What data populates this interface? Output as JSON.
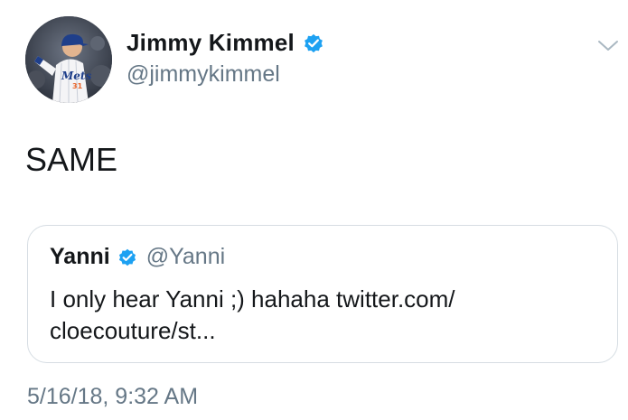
{
  "tweet": {
    "author": {
      "name": "Jimmy Kimmel",
      "handle": "@jimmykimmel",
      "verified": true,
      "avatar_icon": "profile-photo"
    },
    "text": "SAME",
    "quoted_tweet": {
      "author_name": "Yanni",
      "author_handle": "@Yanni",
      "verified": true,
      "text_line_1": "I only hear Yanni ;) hahaha twitter.com/",
      "text_line_2": "cloecouture/st..."
    },
    "timestamp": "5/16/18, 9:32 AM",
    "menu_icon": "chevron-down-icon"
  },
  "colors": {
    "text_primary": "#14171a",
    "text_secondary": "#657786",
    "verified_blue": "#1da1f2",
    "border": "#d6dde3"
  }
}
